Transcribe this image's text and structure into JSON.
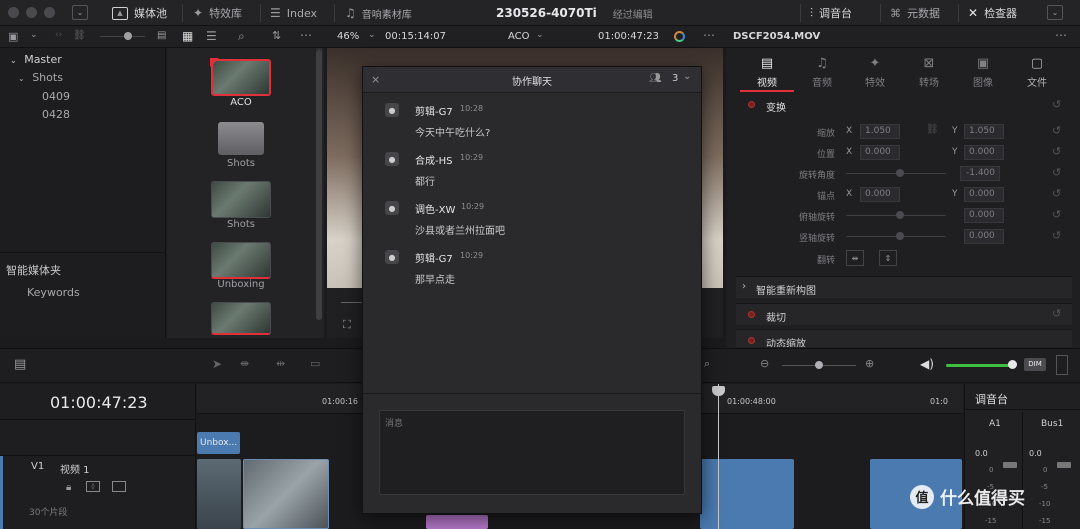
{
  "topbar": {
    "media_pool": "媒体池",
    "effects": "特效库",
    "index": "Index",
    "sound_library": "音响素材库",
    "project_title": "230526-4070Ti",
    "edit_status": "经过编辑",
    "mixer": "调音台",
    "metadata": "元数据",
    "inspector": "检查器"
  },
  "viewer_bar": {
    "zoom": "46%",
    "source_timecode": "00:15:14:07",
    "clip_name": "ACO",
    "record_timecode": "01:00:47:23"
  },
  "media_tree": {
    "root": "Master",
    "folder": "Shots",
    "items": [
      "0409",
      "0428"
    ],
    "smart_bins_title": "智能媒体夹",
    "smart_bins_items": [
      "Keywords"
    ]
  },
  "media_pool_items": [
    {
      "label": "ACO"
    },
    {
      "label": "Shots"
    },
    {
      "label": "Shots"
    },
    {
      "label": "Unboxing"
    }
  ],
  "chat": {
    "title": "协作聊天",
    "user_count": "3",
    "placeholder": "消息",
    "messages": [
      {
        "sender": "剪辑-G7",
        "time": "10:28",
        "text": "今天中午吃什么?"
      },
      {
        "sender": "合成-HS",
        "time": "10:29",
        "text": "都行"
      },
      {
        "sender": "调色-XW",
        "time": "10:29",
        "text": "沙县或者兰州拉面吧"
      },
      {
        "sender": "剪辑-G7",
        "time": "10:29",
        "text": "那早点走"
      }
    ]
  },
  "inspector": {
    "clip_title": "DSCF2054.MOV",
    "tabs": [
      "视频",
      "音频",
      "特效",
      "转场",
      "图像",
      "文件"
    ],
    "active_tab": "视频",
    "transform_title": "变换",
    "zoom_label": "缩放",
    "zoom_x": "1.050",
    "zoom_y": "1.050",
    "position_label": "位置",
    "position_x": "0.000",
    "position_y": "0.000",
    "rotation_label": "旋转角度",
    "rotation_value": "-1.400",
    "anchor_label": "锚点",
    "anchor_x": "0.000",
    "anchor_y": "0.000",
    "pitch_label": "俯轴旋转",
    "pitch_value": "0.000",
    "yaw_label": "竖轴旋转",
    "yaw_value": "0.000",
    "flip_label": "翻转",
    "x_label": "X",
    "y_label": "Y",
    "smart_reframe": "智能重新构图",
    "crop": "裁切",
    "dynamic_zoom": "动态缩放"
  },
  "timeline": {
    "timecode": "01:00:47:23",
    "ruler_marks": [
      "01:00:16",
      "01:00:48:00",
      "01:0"
    ],
    "clip_label": "Unbox...",
    "track_id": "V1",
    "track_name": "视频 1",
    "clip_count": "30个片段",
    "dim_label": "DIM"
  },
  "mixer": {
    "title": "调音台",
    "channels": [
      "A1",
      "Bus1"
    ],
    "level_values": [
      "0.0",
      "0.0"
    ],
    "scale": [
      "0",
      "-5",
      "-10",
      "-15"
    ]
  },
  "watermark": "值 什么值得买",
  "colors": {
    "accent_red": "#e0303a",
    "volume_green": "#3fbf3f",
    "clip_blue": "#4a7ab0",
    "clip_purple": "#b477c9"
  }
}
